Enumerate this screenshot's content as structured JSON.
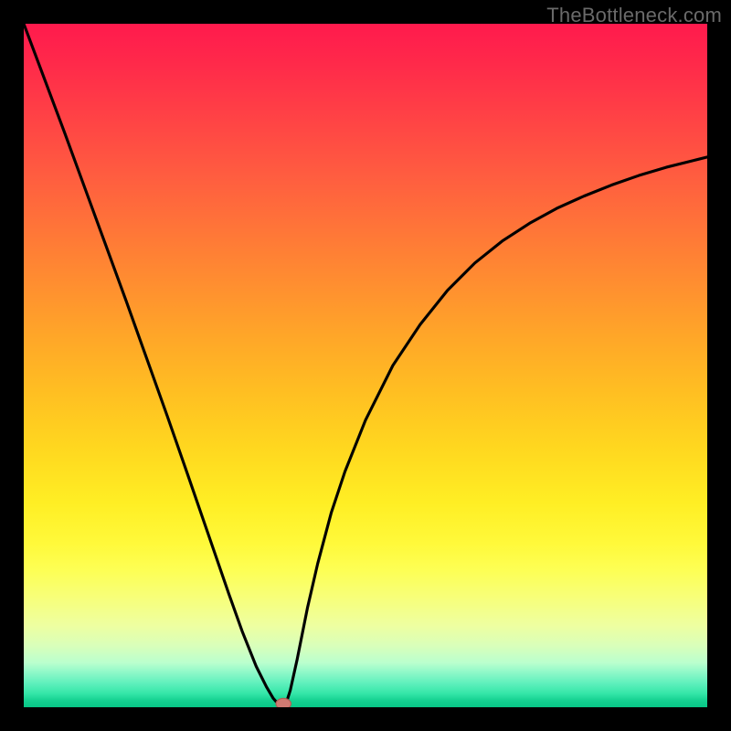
{
  "watermark": "TheBottleneck.com",
  "chart_data": {
    "type": "line",
    "title": "",
    "xlabel": "",
    "ylabel": "",
    "xlim": [
      0,
      1
    ],
    "ylim": [
      0,
      1
    ],
    "series": [
      {
        "name": "curve",
        "x": [
          0.0,
          0.03,
          0.06,
          0.09,
          0.12,
          0.15,
          0.18,
          0.21,
          0.24,
          0.27,
          0.3,
          0.32,
          0.34,
          0.355,
          0.365,
          0.372,
          0.378,
          0.38,
          0.384,
          0.39,
          0.4,
          0.415,
          0.43,
          0.45,
          0.47,
          0.5,
          0.54,
          0.58,
          0.62,
          0.66,
          0.7,
          0.74,
          0.78,
          0.82,
          0.86,
          0.9,
          0.94,
          0.98,
          1.0
        ],
        "values": [
          1.0,
          0.92,
          0.84,
          0.758,
          0.676,
          0.594,
          0.51,
          0.426,
          0.34,
          0.253,
          0.166,
          0.11,
          0.06,
          0.03,
          0.013,
          0.005,
          0.001,
          0.001,
          0.006,
          0.025,
          0.07,
          0.145,
          0.21,
          0.285,
          0.345,
          0.42,
          0.5,
          0.56,
          0.61,
          0.65,
          0.682,
          0.708,
          0.73,
          0.748,
          0.764,
          0.778,
          0.79,
          0.8,
          0.805
        ]
      }
    ],
    "marker": {
      "x": 0.38,
      "y": 0.0
    }
  },
  "colors": {
    "curve": "#000000",
    "marker_fill": "#cf7a72",
    "marker_stroke": "#b25a52",
    "frame": "#000000"
  }
}
